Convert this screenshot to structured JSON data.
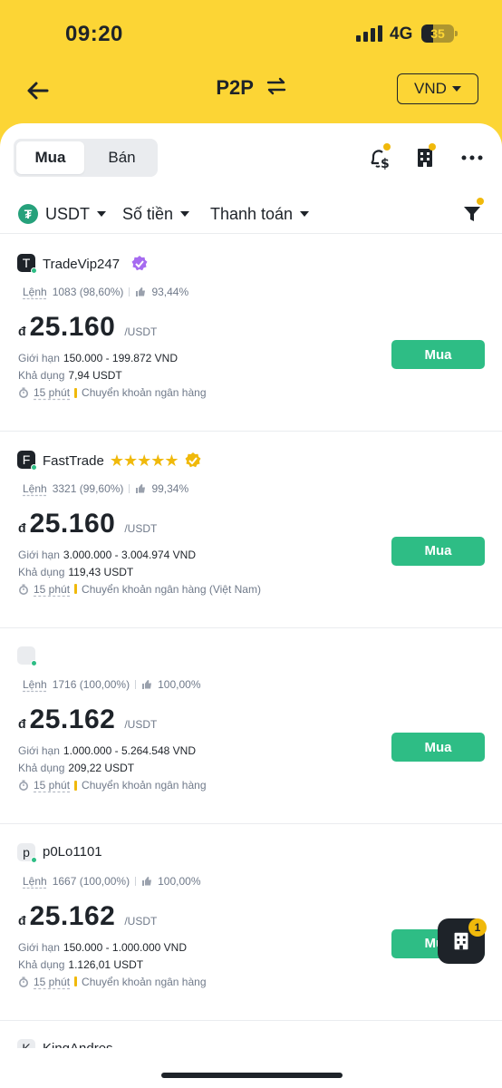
{
  "status_bar": {
    "time": "09:20",
    "network": "4G",
    "battery": "35",
    "battery_level": 0.35
  },
  "nav": {
    "title": "P2P",
    "currency": "VND"
  },
  "tabs": [
    {
      "label": "Mua",
      "active": true
    },
    {
      "label": "Bán",
      "active": false
    }
  ],
  "icons": {
    "back": "arrow-left-icon",
    "swap": "swap-arrows-icon",
    "notify": "bell-dollar-icon",
    "merchant": "building-icon",
    "more": "more-dots-icon",
    "filter": "funnel-icon",
    "fab": "building-icon"
  },
  "filters": {
    "asset": "USDT",
    "amount": "Số tiền",
    "payment": "Thanh toán"
  },
  "labels": {
    "orders": "Lệnh",
    "limit": "Giới hạn",
    "available": "Khả dụng",
    "currency_symbol": "đ",
    "unit": "/USDT"
  },
  "listings": [
    {
      "initial": "T",
      "name": "TradeVip247",
      "stars": "",
      "badge": "purple-verified-icon",
      "orders": "1083 (98,60%)",
      "rating": "93,44%",
      "price": "25.160",
      "limit": "150.000 - 199.872 VND",
      "available": "7,94 USDT",
      "time": "15 phút",
      "payment": "Chuyển khoản ngân hàng",
      "button": "Mua"
    },
    {
      "initial": "F",
      "name": "FastTrade",
      "stars": "★★★★★",
      "badge": "gold-verified-icon",
      "orders": "3321 (99,60%)",
      "rating": "99,34%",
      "price": "25.160",
      "limit": "3.000.000 - 3.004.974 VND",
      "available": "119,43 USDT",
      "time": "15 phút",
      "payment": "Chuyển khoản ngân hàng (Việt Nam)",
      "button": "Mua"
    },
    {
      "initial": "",
      "name": "",
      "stars": "",
      "badge": "",
      "orders": "1716 (100,00%)",
      "rating": "100,00%",
      "price": "25.162",
      "limit": "1.000.000 - 5.264.548 VND",
      "available": "209,22 USDT",
      "time": "15 phút",
      "payment": "Chuyển khoản ngân hàng",
      "button": "Mua"
    },
    {
      "initial": "p",
      "name": "p0Lo1101",
      "stars": "",
      "badge": "",
      "orders": "1667 (100,00%)",
      "rating": "100,00%",
      "price": "25.162",
      "limit": "150.000 - 1.000.000 VND",
      "available": "1.126,01 USDT",
      "time": "15 phút",
      "payment": "Chuyển khoản ngân hàng",
      "button": "Mua"
    }
  ],
  "partial_listing": {
    "initial": "K",
    "name": "KingAndres"
  },
  "fab": {
    "badge": "1"
  }
}
